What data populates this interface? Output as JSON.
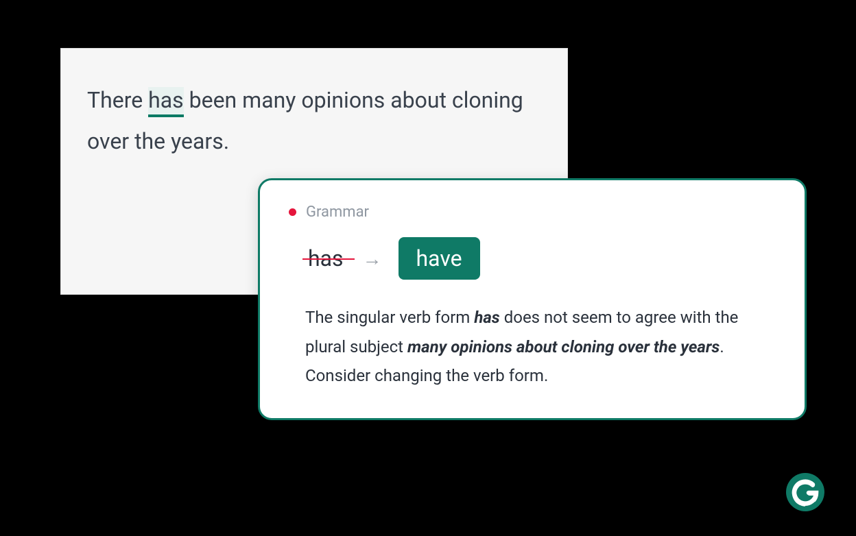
{
  "sentence": {
    "before": "There ",
    "flagged": "has",
    "after": " been many opinions about cloning over the years."
  },
  "suggestion": {
    "category": "Grammar",
    "original": "has",
    "replacement": "have",
    "arrow": "→",
    "explanation": {
      "p1": "The singular verb form ",
      "b1": "has",
      "p2": " does not seem to agree with the plural subject ",
      "b2": "many opinions about cloning over the years",
      "p3": ". Consider changing the verb form."
    }
  },
  "colors": {
    "accent": "#0f7a66",
    "error": "#e5153c"
  }
}
